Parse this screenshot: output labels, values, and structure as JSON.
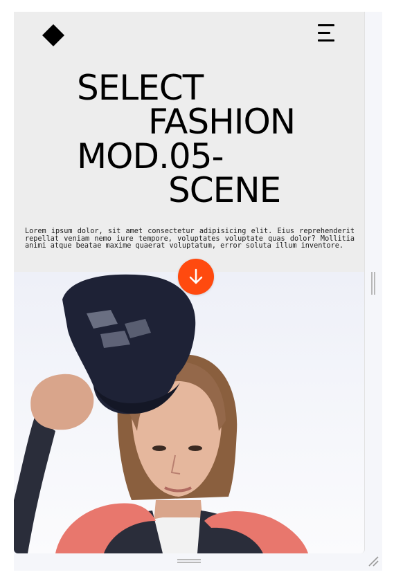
{
  "hero": {
    "title_lines": [
      "SELECT",
      "FASHION",
      "MOD.05-",
      "SCENE"
    ],
    "description": "Lorem ipsum dolor, sit amet consectetur adipisicing elit. Eius reprehenderit repellat veniam nemo iure tempore, voluptates voluptate quas dolor? Mollitia animi atque beatae maxime quaerat voluptatum, error soluta illum inventore."
  },
  "icons": {
    "logo": "diamond-logo",
    "menu": "hamburger-menu-icon",
    "scroll": "arrow-down-icon"
  },
  "colors": {
    "page_bg": "#ededed",
    "text": "#000000",
    "accent": "#ff4a0f",
    "frame_bg": "#f5f6fa"
  }
}
